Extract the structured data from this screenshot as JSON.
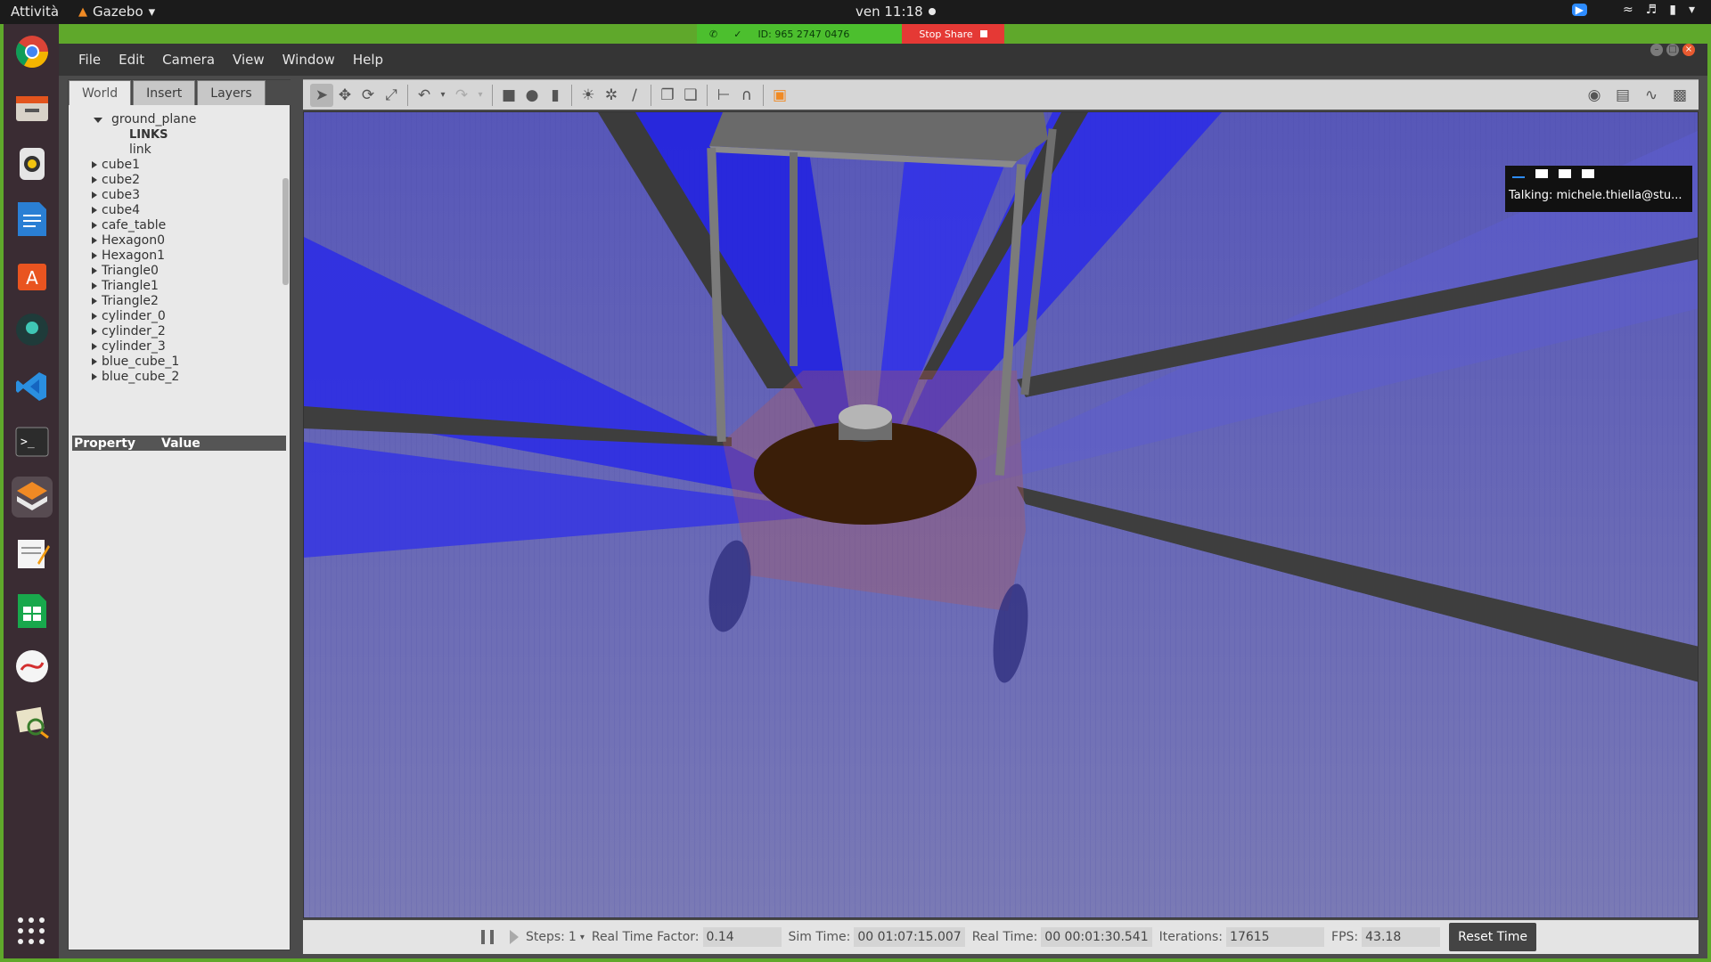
{
  "topbar": {
    "activities": "Attività",
    "app_name": "Gazebo",
    "clock": "ven 11:18"
  },
  "share": {
    "meeting_id": "ID: 965 2747 0476",
    "stop_label": "Stop Share"
  },
  "menu": {
    "items": [
      "File",
      "Edit",
      "Camera",
      "View",
      "Window",
      "Help"
    ]
  },
  "left_panel": {
    "tabs": [
      "World",
      "Insert",
      "Layers"
    ],
    "active_tab": "World",
    "tree": {
      "root": "ground_plane",
      "links_header": "LINKS",
      "link": "link",
      "models": [
        "cube1",
        "cube2",
        "cube3",
        "cube4",
        "cafe_table",
        "Hexagon0",
        "Hexagon1",
        "Triangle0",
        "Triangle1",
        "Triangle2",
        "cylinder_0",
        "cylinder_2",
        "cylinder_3",
        "blue_cube_1",
        "blue_cube_2"
      ]
    },
    "property_header": {
      "property": "Property",
      "value": "Value"
    }
  },
  "zoom_overlay": {
    "talking": "Talking: michele.thiella@stu..."
  },
  "statusbar": {
    "steps_label": "Steps:",
    "steps_value": "1",
    "rtf_label": "Real Time Factor:",
    "rtf_value": "0.14",
    "sim_time_label": "Sim Time:",
    "sim_time_value": "00 01:07:15.007",
    "real_time_label": "Real Time:",
    "real_time_value": "00 00:01:30.541",
    "iterations_label": "Iterations:",
    "iterations_value": "17615",
    "fps_label": "FPS:",
    "fps_value": "43.18",
    "reset_label": "Reset Time"
  },
  "colors": {
    "dock_bg": "#3a2c33",
    "share_green": "#4cbf2e",
    "share_red": "#e53935",
    "viewport_blue": "#6b6bb3",
    "laser_blue": "#1f1fe0",
    "robot_base": "#3a1e08"
  }
}
